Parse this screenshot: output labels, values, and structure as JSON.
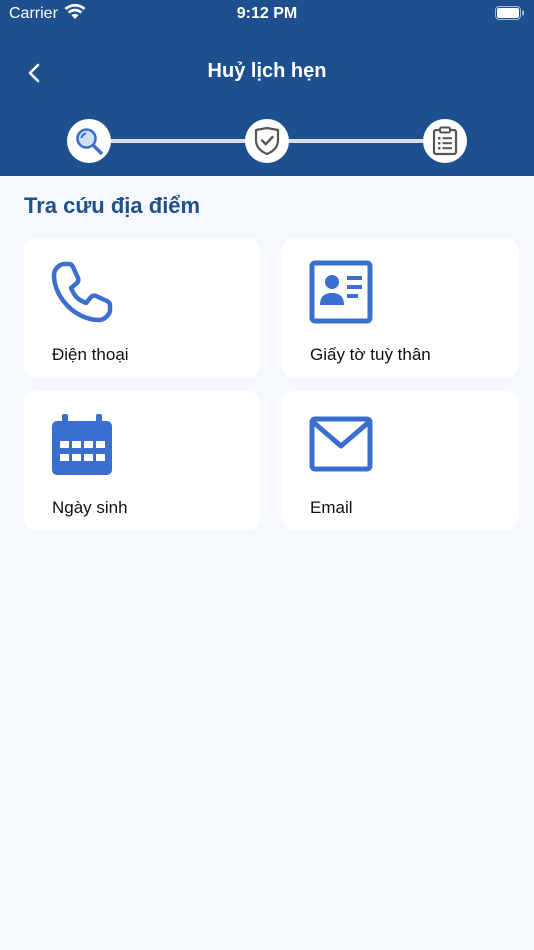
{
  "status_bar": {
    "carrier": "Carrier",
    "time": "9:12 PM"
  },
  "header": {
    "title": "Huỷ lịch hẹn"
  },
  "stepper": {
    "steps": [
      "search-icon",
      "shield-check-icon",
      "clipboard-icon"
    ]
  },
  "section": {
    "title": "Tra cứu địa điểm"
  },
  "options": [
    {
      "label": "Điện thoại",
      "icon": "phone-icon"
    },
    {
      "label": "Giấy tờ tuỳ thân",
      "icon": "id-card-icon"
    },
    {
      "label": "Ngày sinh",
      "icon": "calendar-icon"
    },
    {
      "label": "Email",
      "icon": "envelope-icon"
    }
  ],
  "colors": {
    "header_bg": "#1e4f8e",
    "accent": "#3a6fd0",
    "page_bg": "#f5f9fd"
  }
}
